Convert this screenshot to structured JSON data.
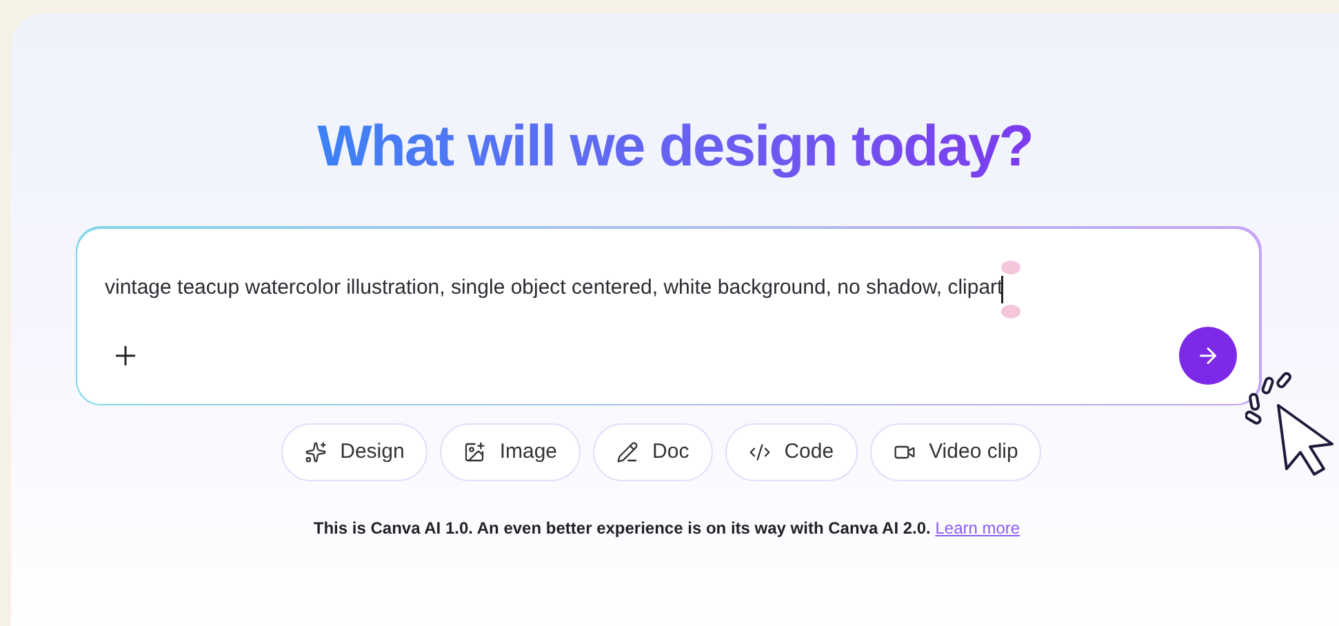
{
  "heading": "What will we design today?",
  "prompt": {
    "value": "vintage teacup watercolor illustration, single object centered, white background, no shadow, clipart"
  },
  "chips": [
    {
      "kind": "design",
      "label": "Design"
    },
    {
      "kind": "image",
      "label": "Image"
    },
    {
      "kind": "doc",
      "label": "Doc"
    },
    {
      "kind": "code",
      "label": "Code"
    },
    {
      "kind": "video",
      "label": "Video clip"
    }
  ],
  "notice": {
    "text": "This is Canva AI 1.0. An even better experience is on its way with Canva AI 2.0.",
    "link": "Learn more"
  }
}
